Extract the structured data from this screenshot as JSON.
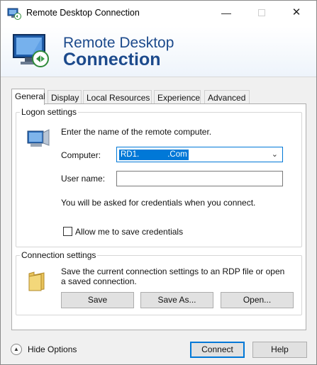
{
  "window": {
    "title": "Remote Desktop Connection",
    "minimize_glyph": "—",
    "close_glyph": "✕"
  },
  "banner": {
    "line1": "Remote Desktop",
    "line2": "Connection"
  },
  "tabs": [
    {
      "label": "General",
      "active": true
    },
    {
      "label": "Display",
      "active": false
    },
    {
      "label": "Local Resources",
      "active": false
    },
    {
      "label": "Experience",
      "active": false
    },
    {
      "label": "Advanced",
      "active": false
    }
  ],
  "logon": {
    "legend": "Logon settings",
    "instruction": "Enter the name of the remote computer.",
    "computer_label": "Computer:",
    "computer_value_prefix": "RD1.",
    "computer_value_suffix": ".Com",
    "username_label": "User name:",
    "username_value": "",
    "credentials_note": "You will be asked for credentials when you connect.",
    "save_credentials_label": "Allow me to save credentials",
    "save_credentials_checked": false
  },
  "connection": {
    "legend": "Connection settings",
    "description": "Save the current connection settings to an RDP file or open a saved connection.",
    "save_label": "Save",
    "save_as_label": "Save As...",
    "open_label": "Open..."
  },
  "footer": {
    "hide_options_label": "Hide Options",
    "connect_label": "Connect",
    "help_label": "Help"
  },
  "colors": {
    "accent": "#0078d7",
    "banner_text": "#1c4a8c"
  },
  "icons": {
    "app": "rdp-monitor-icon",
    "banner": "rdp-monitor-large-icon",
    "logon": "computer-icon",
    "connection": "folder-icon",
    "hide_options": "chevron-up-circle-icon",
    "combo": "chevron-down-icon"
  }
}
